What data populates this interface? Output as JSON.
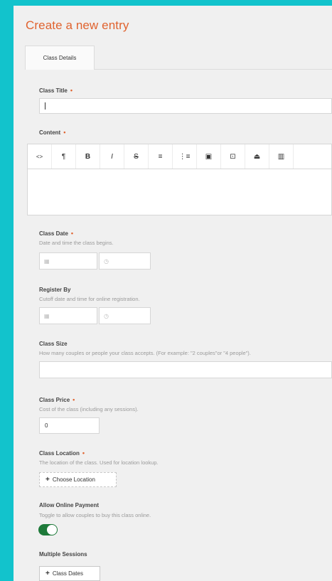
{
  "page": {
    "title": "Create a new entry"
  },
  "tabs": [
    {
      "label": "Class Details",
      "active": true
    }
  ],
  "fields": {
    "class_title": {
      "label": "Class Title",
      "required": "•",
      "value": ""
    },
    "content": {
      "label": "Content",
      "required": "•",
      "toolbar": [
        {
          "name": "code-icon",
          "glyph": "<>"
        },
        {
          "name": "paragraph-icon",
          "glyph": "¶"
        },
        {
          "name": "bold-icon",
          "glyph": "B"
        },
        {
          "name": "italic-icon",
          "glyph": "I"
        },
        {
          "name": "strikethrough-icon",
          "glyph": "S"
        },
        {
          "name": "bulleted-list-icon",
          "glyph": "≡"
        },
        {
          "name": "numbered-list-icon",
          "glyph": "⋮≡"
        },
        {
          "name": "image-icon",
          "glyph": "▣"
        },
        {
          "name": "video-icon",
          "glyph": "⊡"
        },
        {
          "name": "embed-icon",
          "glyph": "⏏"
        },
        {
          "name": "table-icon",
          "glyph": "▥"
        }
      ]
    },
    "class_date": {
      "label": "Class Date",
      "required": "•",
      "help": "Date and time the class begins.",
      "date_icon": "▦",
      "time_icon": "◷"
    },
    "register_by": {
      "label": "Register By",
      "help": "Cutoff date and time for online registration.",
      "date_icon": "▦",
      "time_icon": "◷"
    },
    "class_size": {
      "label": "Class Size",
      "help": "How many couples or people your class accepts. (For example: \"2 couples\"or \"4 people\").",
      "value": ""
    },
    "class_price": {
      "label": "Class Price",
      "required": "•",
      "help": "Cost of the class (including any sessions).",
      "value": "0"
    },
    "class_location": {
      "label": "Class Location",
      "required": "•",
      "help": "The location of the class. Used for location lookup.",
      "button": "Choose Location",
      "plus": "+"
    },
    "allow_online_payment": {
      "label": "Allow Online Payment",
      "help": "Toggle to allow couples to buy this class online.",
      "enabled": true
    },
    "multiple_sessions": {
      "label": "Multiple Sessions",
      "button": "Class Dates",
      "plus": "+"
    }
  },
  "colors": {
    "background": "#12c3cc",
    "accent": "#e0632f",
    "toggle_on": "#1e7a3a"
  }
}
